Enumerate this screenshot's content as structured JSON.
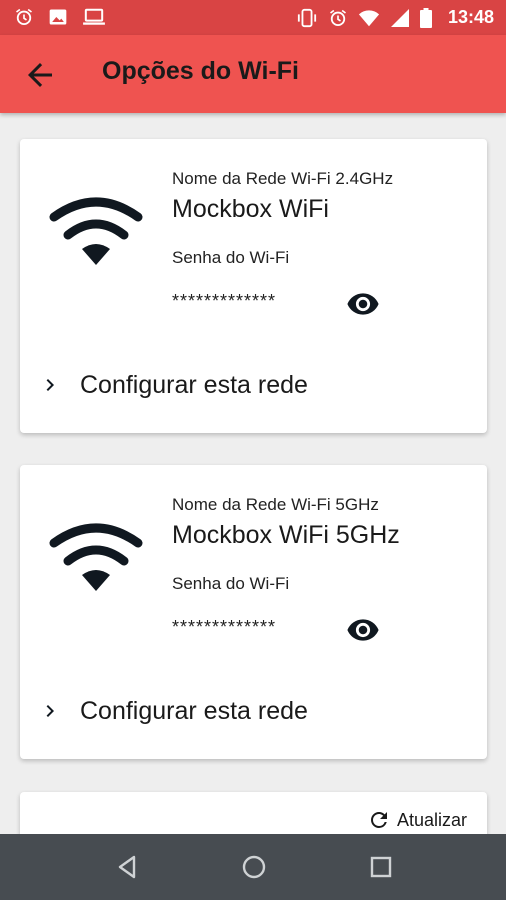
{
  "status_bar": {
    "time": "13:48",
    "left_icons": [
      "alarm-icon",
      "image-icon",
      "laptop-icon"
    ],
    "right_icons": [
      "vibrate-icon",
      "alarm-icon",
      "wifi-signal-icon",
      "cell-signal-icon",
      "battery-icon"
    ]
  },
  "app_bar": {
    "title": "Opções do Wi-Fi",
    "back_icon": "arrow-back-icon"
  },
  "networks": [
    {
      "label": "Nome da Rede Wi-Fi 2.4GHz",
      "name": "Mockbox WiFi",
      "password_label": "Senha do Wi-Fi",
      "password": "*************",
      "configure_label": "Configurar esta rede"
    },
    {
      "label": "Nome da Rede Wi-Fi 5GHz",
      "name": "Mockbox WiFi 5GHz",
      "password_label": "Senha do Wi-Fi",
      "password": "*************",
      "configure_label": "Configurar esta rede"
    }
  ],
  "refresh": {
    "label": "Atualizar"
  },
  "colors": {
    "status_bar": "#d94444",
    "app_bar": "#ef5350",
    "background": "#eeeeee",
    "nav_bar": "#474c51"
  },
  "nav_bar": {
    "icons": [
      "back-triangle-icon",
      "home-circle-icon",
      "recents-square-icon"
    ]
  }
}
